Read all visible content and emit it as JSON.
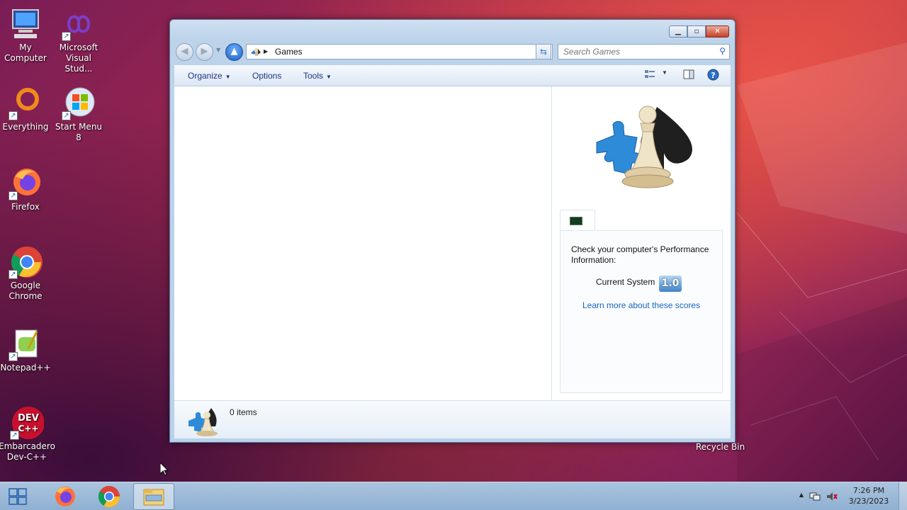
{
  "desktop": {
    "icons": [
      {
        "label": "My Computer"
      },
      {
        "label": "Microsoft Visual Stud..."
      },
      {
        "label": "Everything"
      },
      {
        "label": "Start Menu 8"
      },
      {
        "label": "Firefox"
      },
      {
        "label": "Google Chrome"
      },
      {
        "label": "Notepad++"
      },
      {
        "label": "Embarcadero Dev-C++"
      }
    ],
    "recycle_bin": "Recycle Bin"
  },
  "window": {
    "address": {
      "location": "Games"
    },
    "search": {
      "placeholder": "Search Games"
    },
    "toolbar": {
      "organize": "Organize",
      "options": "Options",
      "tools": "Tools"
    },
    "preview": {
      "message": "Check your computer's Performance Information:",
      "current_system_label": "Current System",
      "score": "1.0",
      "learn_more": "Learn more about these scores"
    },
    "details": {
      "item_count": "0 items"
    }
  },
  "taskbar": {
    "clock_time": "7:26 PM",
    "clock_date": "3/23/2023"
  },
  "colors": {
    "link": "#1565c0",
    "toolbar_text": "#1e3287",
    "taskbar": "#9bb9d8"
  }
}
